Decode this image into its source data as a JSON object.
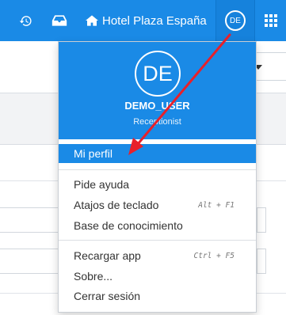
{
  "navbar": {
    "hotel_name": "Hotel Plaza España",
    "user_initials": "DE",
    "icons": [
      "history-icon",
      "inbox-icon",
      "home-icon",
      "apps-grid-icon"
    ]
  },
  "user_menu": {
    "initials": "DE",
    "username": "DEMO_USER",
    "role": "Receptionist",
    "items": [
      {
        "label": "Mi perfil",
        "active": true
      },
      {
        "label": "Pide ayuda"
      },
      {
        "label": "Atajos de teclado",
        "shortcut": "Alt + F1"
      },
      {
        "label": "Base de conocimiento"
      },
      {
        "label": "Recargar app",
        "shortcut": "Ctrl + F5"
      },
      {
        "label": "Sobre..."
      },
      {
        "label": "Cerrar sesión"
      }
    ]
  },
  "colors": {
    "brand_blue": "#1a8ae6",
    "annotation_arrow": "#e8202a"
  }
}
